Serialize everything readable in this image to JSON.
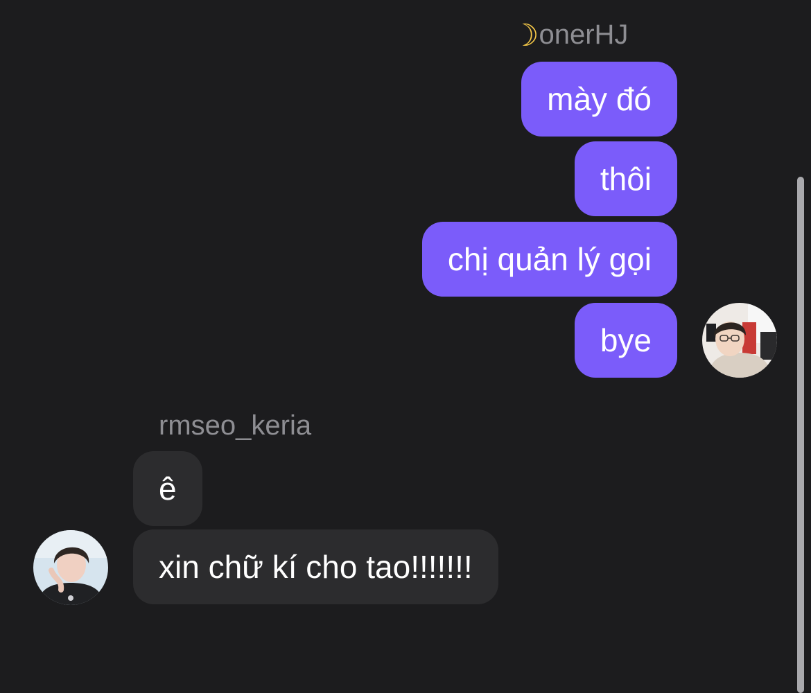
{
  "outgoing": {
    "sender_name": "onerHJ",
    "sender_emoji": "moon-icon",
    "messages": [
      "mày đó",
      "thôi",
      "chị quản lý gọi",
      "bye"
    ]
  },
  "incoming": {
    "sender_name": "rmseo_keria",
    "messages": [
      "ê",
      "xin chữ kí cho tao!!!!!!!"
    ]
  },
  "colors": {
    "background": "#1c1c1e",
    "outgoing_bubble": "#7b5cfa",
    "incoming_bubble": "#2c2c2e",
    "sender_name": "#8e8e93",
    "message_text": "#ffffff"
  }
}
